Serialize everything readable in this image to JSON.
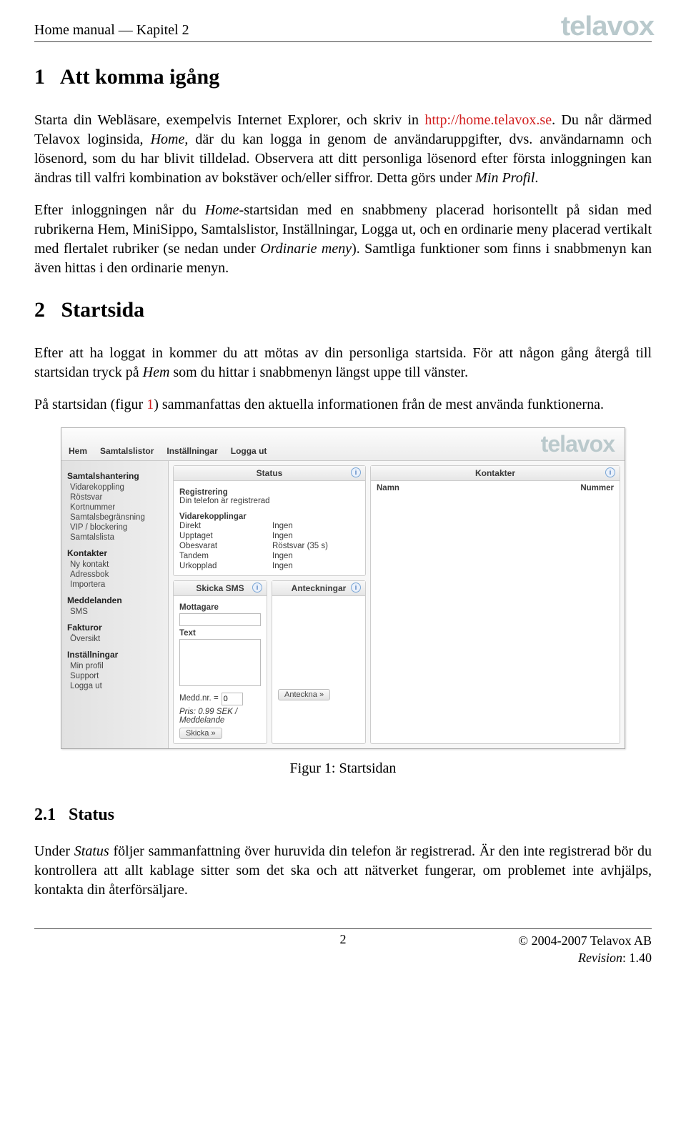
{
  "header": {
    "left": "Home manual — Kapitel 2",
    "brand": "telavox"
  },
  "section1": {
    "number": "1",
    "title": "Att komma igång",
    "p1a": "Starta din Webläsare, exempelvis Internet Explorer, och skriv in ",
    "p1link": "http://home.telavox.se",
    "p1b": ". Du når därmed Telavox loginsida, ",
    "p1home": "Home",
    "p1c": ", där du kan logga in genom de användaruppgifter, dvs. användarnamn och lösenord, som du har blivit tilldelad. Observera att ditt personliga lösenord efter första inloggningen kan ändras till valfri kombination av bokstäver och/eller siffror. Detta görs under ",
    "p1profil": "Min Profil",
    "p1d": ".",
    "p2a": "Efter inloggningen når du ",
    "p2home": "Home",
    "p2b": "-startsidan med en snabbmeny placerad horisontellt på sidan med rubrikerna Hem, MiniSippo, Samtalslistor, Inställningar, Logga ut, och en ordinarie meny placerad vertikalt med flertalet rubriker (se nedan under ",
    "p2ord": "Ordinarie meny",
    "p2c": "). Samtliga funktioner som finns i snabbmenyn kan även hittas i den ordinarie menyn."
  },
  "section2": {
    "number": "2",
    "title": "Startsida",
    "p1a": "Efter att ha loggat in kommer du att mötas av din personliga startsida. För att någon gång återgå till startsidan tryck på ",
    "p1hem": "Hem",
    "p1b": " som du hittar i snabbmenyn längst uppe till vänster.",
    "p2a": "På startsidan (figur ",
    "p2fig": "1",
    "p2b": ") sammanfattas den aktuella informationen från de mest använda funktionerna."
  },
  "figure": {
    "caption": "Figur 1: Startsidan",
    "brand": "telavox",
    "tabs": [
      "Hem",
      "Samtalslistor",
      "Inställningar",
      "Logga ut"
    ],
    "sidebar": [
      {
        "title": "Samtalshantering",
        "items": [
          "Vidarekoppling",
          "Röstsvar",
          "Kortnummer",
          "Samtalsbegränsning",
          "VIP / blockering",
          "Samtalslista"
        ]
      },
      {
        "title": "Kontakter",
        "items": [
          "Ny kontakt",
          "Adressbok",
          "Importera"
        ]
      },
      {
        "title": "Meddelanden",
        "items": [
          "SMS"
        ]
      },
      {
        "title": "Fakturor",
        "items": [
          "Översikt"
        ]
      },
      {
        "title": "Inställningar",
        "items": [
          "Min profil",
          "Support",
          "Logga ut"
        ]
      }
    ],
    "status": {
      "title": "Status",
      "reg_label": "Registrering",
      "reg_text": "Din telefon är registrerad",
      "fwd_label": "Vidarekopplingar",
      "rows": [
        {
          "k": "Direkt",
          "v": "Ingen"
        },
        {
          "k": "Upptaget",
          "v": "Ingen"
        },
        {
          "k": "Obesvarat",
          "v": "Röstsvar (35 s)"
        },
        {
          "k": "Tandem",
          "v": "Ingen"
        },
        {
          "k": "Urkopplad",
          "v": "Ingen"
        }
      ]
    },
    "sms": {
      "title": "Skicka SMS",
      "recipient_label": "Mottagare",
      "text_label": "Text",
      "medd_label": "Medd.nr. =",
      "medd_value": "0",
      "price": "Pris: 0.99 SEK / Meddelande",
      "send": "Skicka",
      "send_arrow": "»"
    },
    "notes": {
      "title": "Anteckningar",
      "btn": "Anteckna",
      "btn_arrow": "»"
    },
    "contacts": {
      "title": "Kontakter",
      "col1": "Namn",
      "col2": "Nummer"
    }
  },
  "section21": {
    "number": "2.1",
    "title": "Status",
    "p1a": "Under ",
    "p1status": "Status",
    "p1b": " följer sammanfattning över huruvida din telefon är registrerad. Är den inte registrerad bör du kontrollera att allt kablage sitter som det ska och att nätverket fungerar, om problemet inte avhjälps, kontakta din återförsäljare."
  },
  "footer": {
    "page": "2",
    "copyright": "© 2004-2007 Telavox AB",
    "rev_label": "Revision",
    "rev_value": ": 1.40"
  }
}
